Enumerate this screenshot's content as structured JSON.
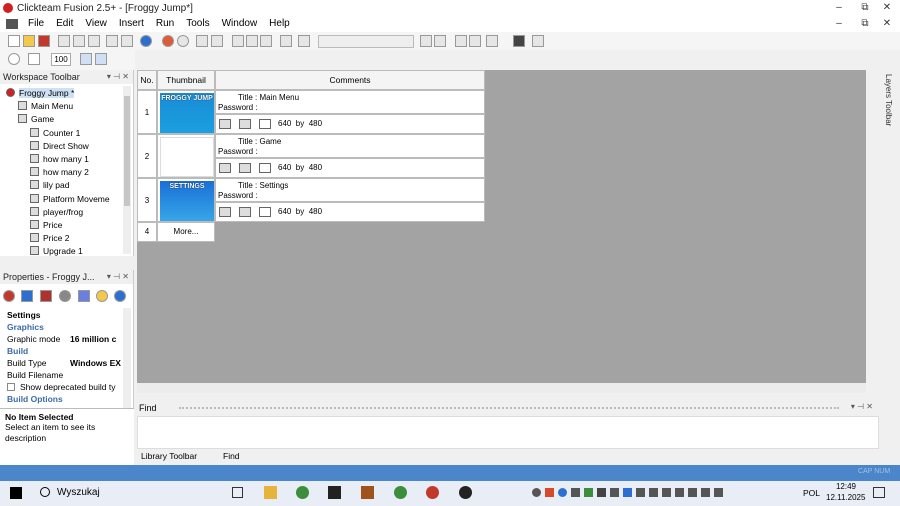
{
  "window": {
    "title": "Clickteam Fusion 2.5+ - [Froggy Jump*]",
    "minimize": "–",
    "restore": "⧉",
    "close": "✕",
    "inner_minimize": "–",
    "inner_restore": "⧉",
    "inner_close": "✕"
  },
  "menu": [
    "File",
    "Edit",
    "View",
    "Insert",
    "Run",
    "Tools",
    "Window",
    "Help"
  ],
  "toolbar": {
    "zoom_value": "100"
  },
  "workspace": {
    "title": "Workspace Toolbar",
    "items": [
      {
        "label": "Froggy Jump *",
        "level": 0
      },
      {
        "label": "Main Menu",
        "level": 1
      },
      {
        "label": "Game",
        "level": 1
      },
      {
        "label": "Counter 1",
        "level": 2
      },
      {
        "label": "Direct Show",
        "level": 2
      },
      {
        "label": "how many 1",
        "level": 2
      },
      {
        "label": "how many 2",
        "level": 2
      },
      {
        "label": "lily pad",
        "level": 2
      },
      {
        "label": "Platform Moveme",
        "level": 2
      },
      {
        "label": "player/frog",
        "level": 2
      },
      {
        "label": "Price",
        "level": 2
      },
      {
        "label": "Price 2",
        "level": 2
      },
      {
        "label": "Upgrade 1",
        "level": 2
      }
    ]
  },
  "properties": {
    "title": "Properties - Froggy J...",
    "rows": [
      {
        "label": "Settings",
        "value": "",
        "kind": "section"
      },
      {
        "label": "Graphics",
        "value": "",
        "kind": "head"
      },
      {
        "label": "Graphic mode",
        "value": "16 million c",
        "kind": "row"
      },
      {
        "label": "Build",
        "value": "",
        "kind": "head"
      },
      {
        "label": "Build Type",
        "value": "Windows EX",
        "kind": "row"
      },
      {
        "label": "Build Filename",
        "value": "",
        "kind": "row"
      },
      {
        "label": "Show deprecated build ty",
        "value": "",
        "kind": "check"
      },
      {
        "label": "Build Options",
        "value": "",
        "kind": "head"
      }
    ],
    "desc_title": "No Item Selected",
    "desc_text": "Select an item to see its description"
  },
  "storyboard": {
    "headers": {
      "no": "No.",
      "thumb": "Thumbnail",
      "comments": "Comments"
    },
    "frames": [
      {
        "no": "1",
        "title": "Title : Main Menu",
        "password": "Password :",
        "size": "640  by  480",
        "thumb_text": "FROGGY JUMP"
      },
      {
        "no": "2",
        "title": "Title : Game",
        "password": "Password :",
        "size": "640  by  480",
        "thumb_text": ""
      },
      {
        "no": "3",
        "title": "Title : Settings",
        "password": "Password :",
        "size": "640  by  480",
        "thumb_text": "SETTINGS"
      }
    ],
    "more": {
      "no": "4",
      "label": "More..."
    }
  },
  "layers_toolbar": "Layers Toolbar",
  "find": {
    "title": "Find",
    "tabs": [
      "Library Toolbar",
      "Find"
    ]
  },
  "status": {
    "text": "CAP NUM"
  },
  "taskbar": {
    "search": "Wyszukaj",
    "language": "POL",
    "time": "12:49",
    "date": "12.11.2025"
  }
}
